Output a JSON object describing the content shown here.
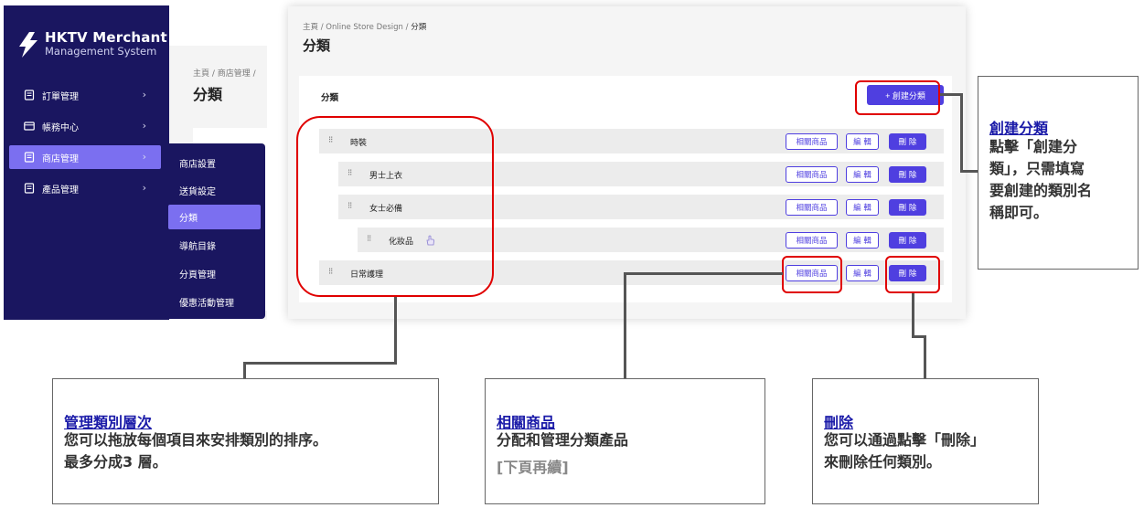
{
  "sidebar": {
    "logo_title": "HKTV Merchant",
    "logo_subtitle": "Management System",
    "items": [
      {
        "label": "訂單管理",
        "icon": "clipboard-icon"
      },
      {
        "label": "帳務中心",
        "icon": "card-icon"
      },
      {
        "label": "商店管理",
        "icon": "clipboard-icon"
      },
      {
        "label": "產品管理",
        "icon": "clipboard-icon"
      }
    ],
    "chevron": "›"
  },
  "submenu": {
    "items": [
      "商店設置",
      "送貨設定",
      "分類",
      "導航目錄",
      "分頁管理",
      "優惠活動管理"
    ]
  },
  "background_page": {
    "crumb": "主頁 / 商店管理 /",
    "title": "分類"
  },
  "main": {
    "crumb_home": "主頁",
    "crumb_mid": "Online Store Design",
    "crumb_current": "分類",
    "crumb_sep": "/",
    "title": "分類",
    "card_title": "分類",
    "create_button": "+ 創建分類",
    "rows": [
      {
        "label": "時裝"
      },
      {
        "label": "男士上衣"
      },
      {
        "label": "女士必備"
      },
      {
        "label": "化妝品"
      },
      {
        "label": "日常護理"
      }
    ],
    "grip": "⁝⁝",
    "btn_related": "相關商品",
    "btn_edit": "編 輯",
    "btn_delete": "刪 除"
  },
  "callouts": {
    "create": {
      "title": "創建分類",
      "lines": [
        "點擊「創建分",
        "類」，只需填寫",
        "要創建的類別名",
        "稱即可。"
      ]
    },
    "hierarchy": {
      "title": "管理類別層次",
      "lines": [
        "您可以拖放每個項目來安排類別的排序。",
        "最多分成3 層。"
      ]
    },
    "related": {
      "title": "相關商品",
      "lines": [
        "分配和管理分類產品"
      ],
      "continued": "[下頁再續]"
    },
    "delete": {
      "title": "刪除",
      "lines": [
        "您可以通過點擊「刪除」",
        "來刪除任何類別。"
      ]
    }
  },
  "colors": {
    "sidebar_bg": "#1a1660",
    "accent": "#4f3fe0",
    "active_nav": "#7b6ff0",
    "highlight": "#e00000",
    "callout_title": "#1a1aa8"
  }
}
